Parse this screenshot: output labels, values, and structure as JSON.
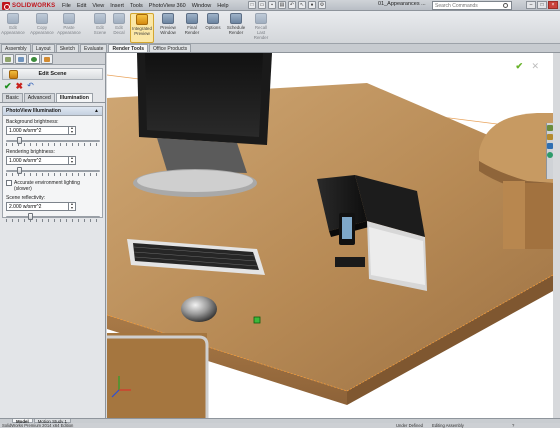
{
  "app": {
    "name": "SOLIDWORKS",
    "document_title": "01_Appearances ..."
  },
  "menu": [
    "File",
    "Edit",
    "View",
    "Insert",
    "Tools",
    "PhotoView 360",
    "Window",
    "Help"
  ],
  "search": {
    "placeholder": "Search Commands"
  },
  "ribbon": {
    "buttons": [
      {
        "label": "Edit\nAppearance",
        "state": "dim"
      },
      {
        "label": "Copy\nAppearance",
        "state": "dim"
      },
      {
        "label": "Paste\nAppearance",
        "state": "dim"
      },
      {
        "label": "Edit\nScene",
        "state": "dim"
      },
      {
        "label": "Edit\nDecal",
        "state": "dim"
      },
      {
        "label": "Integrated\nPreview",
        "state": "active"
      },
      {
        "label": "Preview\nWindow",
        "state": "normal"
      },
      {
        "label": "Final\nRender",
        "state": "normal"
      },
      {
        "label": "Options",
        "state": "normal"
      },
      {
        "label": "Schedule\nRender",
        "state": "normal"
      },
      {
        "label": "Recall\nLast\nRender",
        "state": "dim"
      }
    ]
  },
  "command_tabs": [
    {
      "label": "Assembly",
      "active": false
    },
    {
      "label": "Layout",
      "active": false
    },
    {
      "label": "Sketch",
      "active": false
    },
    {
      "label": "Evaluate",
      "active": false
    },
    {
      "label": "Render Tools",
      "active": true
    },
    {
      "label": "Office Products",
      "active": false
    }
  ],
  "property_manager": {
    "title": "Edit Scene",
    "tabs": [
      {
        "label": "Basic",
        "active": false
      },
      {
        "label": "Advanced",
        "active": false
      },
      {
        "label": "Illumination",
        "active": true
      }
    ],
    "group_title": "PhotoView Illumination",
    "background_brightness": {
      "label": "Background brightness:",
      "value": "1.000 w/srm^2",
      "level": 0.12
    },
    "rendering_brightness": {
      "label": "Rendering brightness:",
      "value": "1.000 w/srm^2",
      "level": 0.12
    },
    "accurate_env_lighting": {
      "label": "Accurate environment lighting (slower)",
      "checked": false
    },
    "scene_reflectivity": {
      "label": "Scene reflectivity:",
      "value": "2.000 w/srm^2",
      "level": 0.25
    }
  },
  "bottom_tabs": [
    {
      "label": "Model",
      "active": true
    },
    {
      "label": "Motion Study 1",
      "active": false
    }
  ],
  "status": {
    "left": "SolidWorks Premium 2014 x64 Edition",
    "defined": "Under Defined",
    "mode": "Editing Assembly"
  },
  "colors": {
    "accent": "#d48a12",
    "ok": "#1e8f1e",
    "cancel": "#c8221d",
    "desk": "#b98a52"
  }
}
